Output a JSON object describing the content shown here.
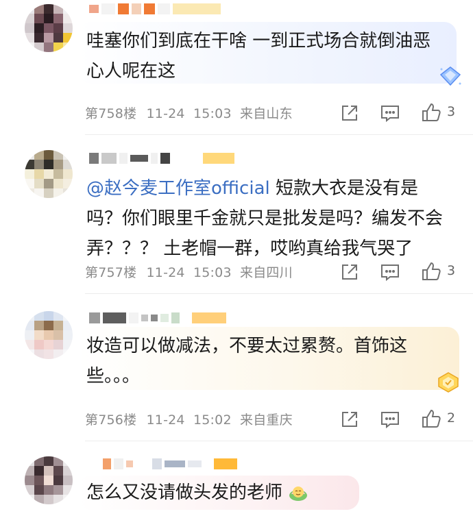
{
  "comments": [
    {
      "text": "哇塞你们到底在干啥 一到正式场合就倒油恶心人呢在这",
      "floor": "第758楼",
      "date": "11-24",
      "time": "15:03",
      "location": "来自山东",
      "likes": "3",
      "badge_icon": "diamond-badge-icon"
    },
    {
      "mention": "@赵今麦工作室official",
      "text": " 短款大衣是没有是吗？你们眼里千金就只是批发是吗？编发不会弄？？？ 土老帽一群，哎哟真给我气哭了",
      "floor": "第757楼",
      "date": "11-24",
      "time": "15:03",
      "location": "来自四川",
      "likes": "3"
    },
    {
      "text": "妆造可以做减法，不要太过累赘。首饰这些。。。",
      "floor": "第756楼",
      "date": "11-24",
      "time": "15:02",
      "location": "来自重庆",
      "likes": "2",
      "badge_icon": "gold-badge-icon"
    },
    {
      "text": "怎么又没请做头发的老师",
      "emoji_icon": "lotus-face-emoji-icon"
    }
  ],
  "icons": {
    "share": "share-icon",
    "comment": "comment-icon",
    "like": "thumbs-up-icon"
  }
}
